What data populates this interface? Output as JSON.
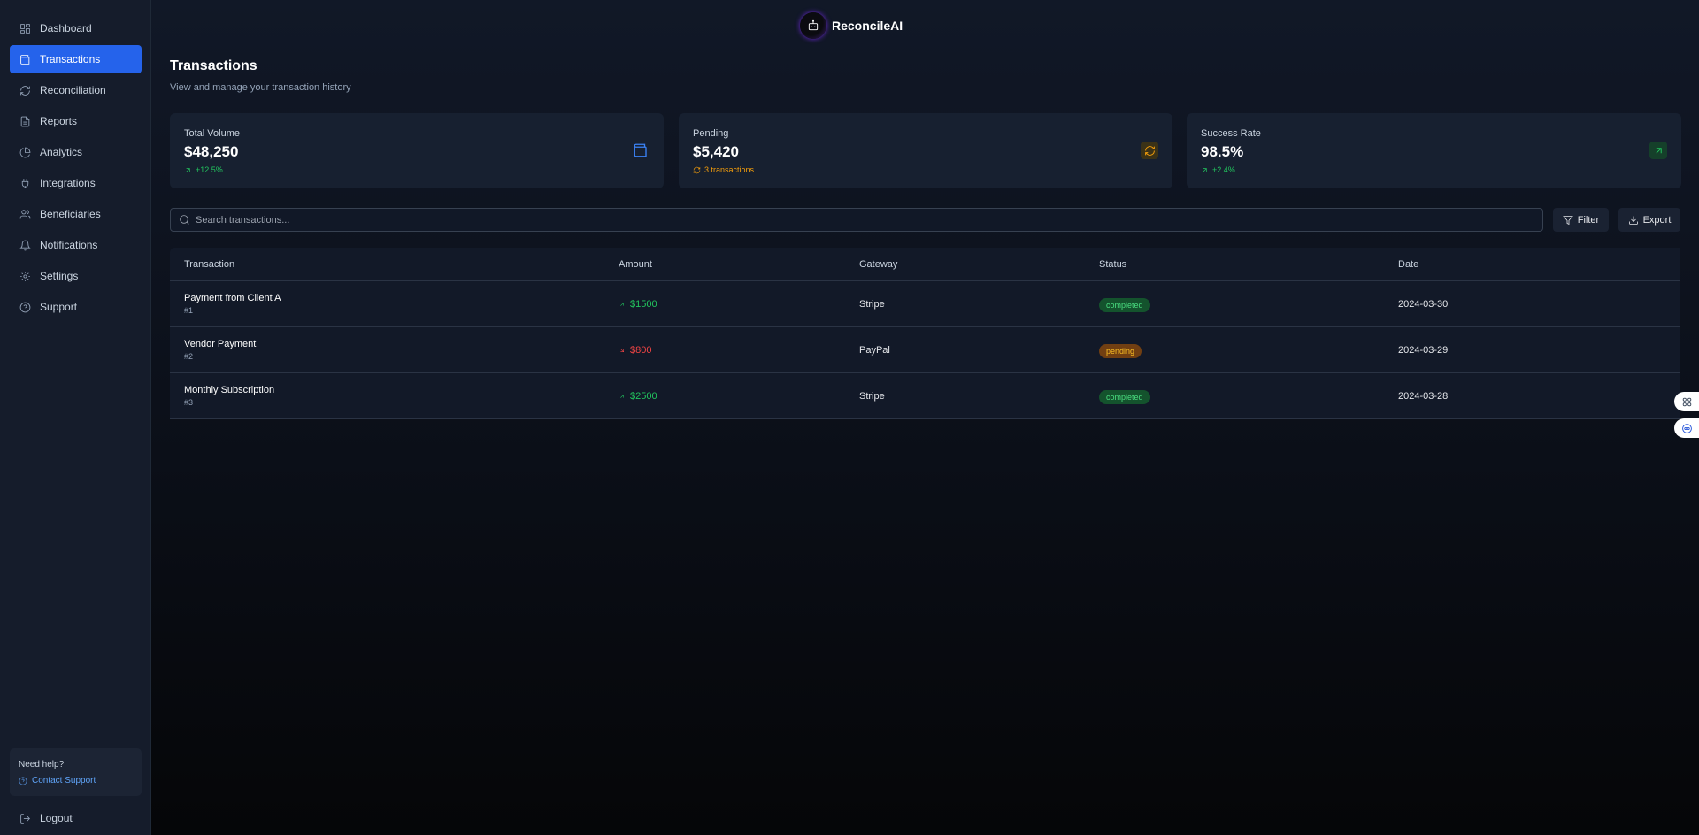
{
  "brand": {
    "name": "ReconcileAI",
    "logo_icon": "robot-icon"
  },
  "sidebar": {
    "items": [
      {
        "label": "Dashboard",
        "icon": "dashboard-icon",
        "active": false
      },
      {
        "label": "Transactions",
        "icon": "wallet-icon",
        "active": true
      },
      {
        "label": "Reconciliation",
        "icon": "refresh-icon",
        "active": false
      },
      {
        "label": "Reports",
        "icon": "file-icon",
        "active": false
      },
      {
        "label": "Analytics",
        "icon": "pie-chart-icon",
        "active": false
      },
      {
        "label": "Integrations",
        "icon": "plug-icon",
        "active": false
      },
      {
        "label": "Beneficiaries",
        "icon": "users-icon",
        "active": false
      },
      {
        "label": "Notifications",
        "icon": "bell-icon",
        "active": false
      },
      {
        "label": "Settings",
        "icon": "gear-icon",
        "active": false
      },
      {
        "label": "Support",
        "icon": "help-circle-icon",
        "active": false
      }
    ],
    "help": {
      "title": "Need help?",
      "link": "Contact Support"
    },
    "logout": "Logout"
  },
  "page": {
    "title": "Transactions",
    "subtitle": "View and manage your transaction history"
  },
  "cards": [
    {
      "label": "Total Volume",
      "value": "$48,250",
      "sub": "+12.5%",
      "sub_color": "#22c55e",
      "sub_icon": "arrow-up-right-icon",
      "icon": "wallet-icon",
      "icon_color": "#3b82f6",
      "icon_bg": "transparent"
    },
    {
      "label": "Pending",
      "value": "$5,420",
      "sub": "3 transactions",
      "sub_color": "#f59e0b",
      "sub_icon": "refresh-icon",
      "icon": "refresh-icon",
      "icon_color": "#f59e0b",
      "icon_bg": "#3b3217"
    },
    {
      "label": "Success Rate",
      "value": "98.5%",
      "sub": "+2.4%",
      "sub_color": "#22c55e",
      "sub_icon": "arrow-up-right-icon",
      "icon": "arrow-up-right-icon",
      "icon_color": "#22c55e",
      "icon_bg": "#15402a"
    }
  ],
  "search": {
    "placeholder": "Search transactions..."
  },
  "actions": {
    "filter": "Filter",
    "export": "Export"
  },
  "table": {
    "headers": [
      "Transaction",
      "Amount",
      "Gateway",
      "Status",
      "Date"
    ],
    "rows": [
      {
        "name": "Payment from Client A",
        "id": "#1",
        "amount": "$1500",
        "direction": "in",
        "gateway": "Stripe",
        "status": "completed",
        "date": "2024-03-30"
      },
      {
        "name": "Vendor Payment",
        "id": "#2",
        "amount": "$800",
        "direction": "out",
        "gateway": "PayPal",
        "status": "pending",
        "date": "2024-03-29"
      },
      {
        "name": "Monthly Subscription",
        "id": "#3",
        "amount": "$2500",
        "direction": "in",
        "gateway": "Stripe",
        "status": "completed",
        "date": "2024-03-28"
      }
    ]
  },
  "colors": {
    "accent": "#2563eb",
    "positive": "#22c55e",
    "negative": "#ef4444",
    "completed_bg": "#14532d",
    "completed_fg": "#4ade80",
    "pending_bg": "#713f12",
    "pending_fg": "#fbbf24"
  },
  "floating": [
    {
      "icon": "grid-icon"
    },
    {
      "icon": "assistant-icon"
    }
  ]
}
